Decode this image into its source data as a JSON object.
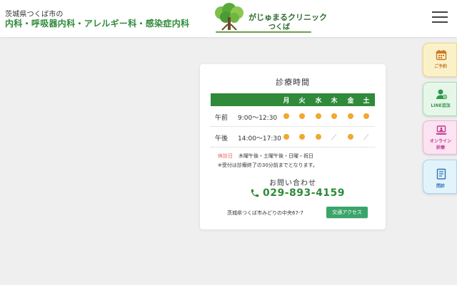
{
  "header": {
    "subtitle": "茨城県つくば市の",
    "departments": "内科・呼吸器内科・アレルギー科・感染症内科",
    "logo_line1": "がじゅまるクリニック",
    "logo_line2": "つくば"
  },
  "schedule": {
    "title": "診療時間",
    "days": [
      "月",
      "火",
      "水",
      "木",
      "金",
      "土"
    ],
    "rows": [
      {
        "period": "午前",
        "time": "9:00～12:30",
        "marks": [
          "open",
          "open",
          "open",
          "open",
          "open",
          "open"
        ]
      },
      {
        "period": "午後",
        "time": "14:00～17:30",
        "marks": [
          "open",
          "open",
          "open",
          "closed",
          "open",
          "closed"
        ]
      }
    ],
    "holiday_label": "休診日",
    "holiday_text": "木曜午後・土曜午後・日曜・祝日",
    "note": "※受付は診療終了の30分前までとなります。"
  },
  "contact": {
    "title": "お問い合わせ",
    "phone": "029-893-4159",
    "address": "茨城県つくば市みどりの中央67-7",
    "access_label": "交通アクセス"
  },
  "side_tabs": {
    "reserve": "ご予約",
    "line": "LINE追加",
    "online_1": "オンライン",
    "online_2": "診療",
    "form": "問診"
  },
  "colors": {
    "brand_green": "#2f8a3a",
    "open_dot": "#f0a830",
    "holiday_red": "#e05a4a",
    "access_button": "#3aa56a"
  },
  "icons": {
    "menu": "hamburger-menu-icon",
    "phone": "phone-icon",
    "reserve": "calendar-icon",
    "line": "person-add-icon",
    "online": "laptop-icon",
    "form": "clipboard-icon"
  }
}
